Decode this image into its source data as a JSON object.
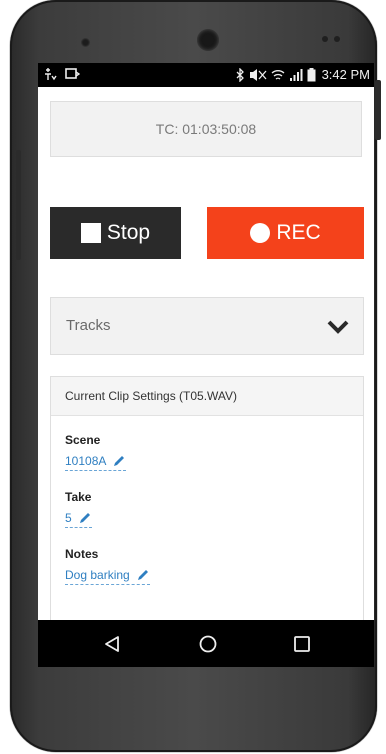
{
  "status_bar": {
    "time": "3:42 PM"
  },
  "timecode": {
    "text": "TC: 01:03:50:08"
  },
  "transport": {
    "stop_label": "Stop",
    "rec_label": "REC",
    "rec_color": "#f4421b",
    "stop_color": "#2a2a2a"
  },
  "tracks": {
    "label": "Tracks"
  },
  "clip_settings": {
    "header": "Current Clip Settings (T05.WAV)",
    "scene_label": "Scene",
    "scene_value": "10108A",
    "take_label": "Take",
    "take_value": "5",
    "notes_label": "Notes",
    "notes_value": "Dog barking"
  },
  "icons": {
    "status_left": [
      "notification-icon",
      "cast-icon"
    ],
    "status_right": [
      "bluetooth-icon",
      "mute-icon",
      "wifi-icon",
      "signal-icon",
      "battery-icon"
    ],
    "nav": [
      "back-icon",
      "home-icon",
      "recents-icon"
    ]
  }
}
